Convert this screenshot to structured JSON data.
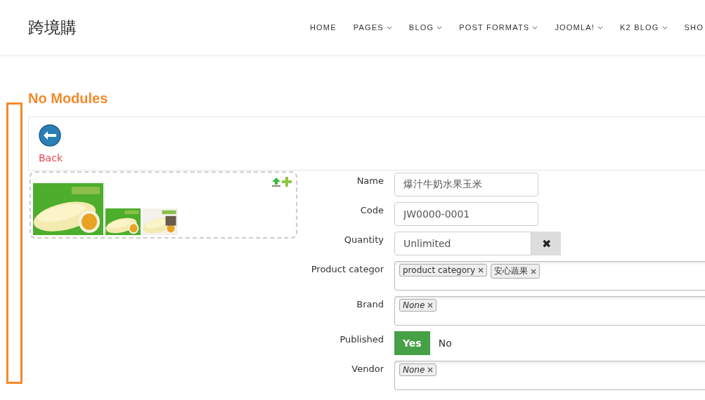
{
  "site_title": "跨境購",
  "nav": [
    {
      "label": "HOME",
      "has_menu": false
    },
    {
      "label": "PAGES",
      "has_menu": true
    },
    {
      "label": "BLOG",
      "has_menu": true
    },
    {
      "label": "POST FORMATS",
      "has_menu": true
    },
    {
      "label": "JOOMLA!",
      "has_menu": true
    },
    {
      "label": "K2 BLOG",
      "has_menu": true
    },
    {
      "label": "SHO",
      "has_menu": false
    }
  ],
  "heading": "No Modules",
  "toolbar": {
    "back_label": "Back"
  },
  "fields": [
    {
      "label": "Name",
      "kind": "text",
      "value": "爆汁牛奶水果玉米"
    },
    {
      "label": "Code",
      "kind": "text",
      "value": "JW0000-0001"
    },
    {
      "label": "Quantity",
      "kind": "clearable",
      "value": "Unlimited",
      "clear_icon": "✖"
    },
    {
      "label": "Product categor",
      "kind": "tags",
      "tags": [
        "product category",
        "安心蔬果"
      ]
    },
    {
      "label": "Brand",
      "kind": "select",
      "value": "None"
    },
    {
      "label": "Published",
      "kind": "toggle",
      "options": [
        {
          "label": "Yes",
          "selected": true
        },
        {
          "label": "No",
          "selected": false
        }
      ]
    },
    {
      "label": "Vendor",
      "kind": "select",
      "value": "None"
    }
  ]
}
